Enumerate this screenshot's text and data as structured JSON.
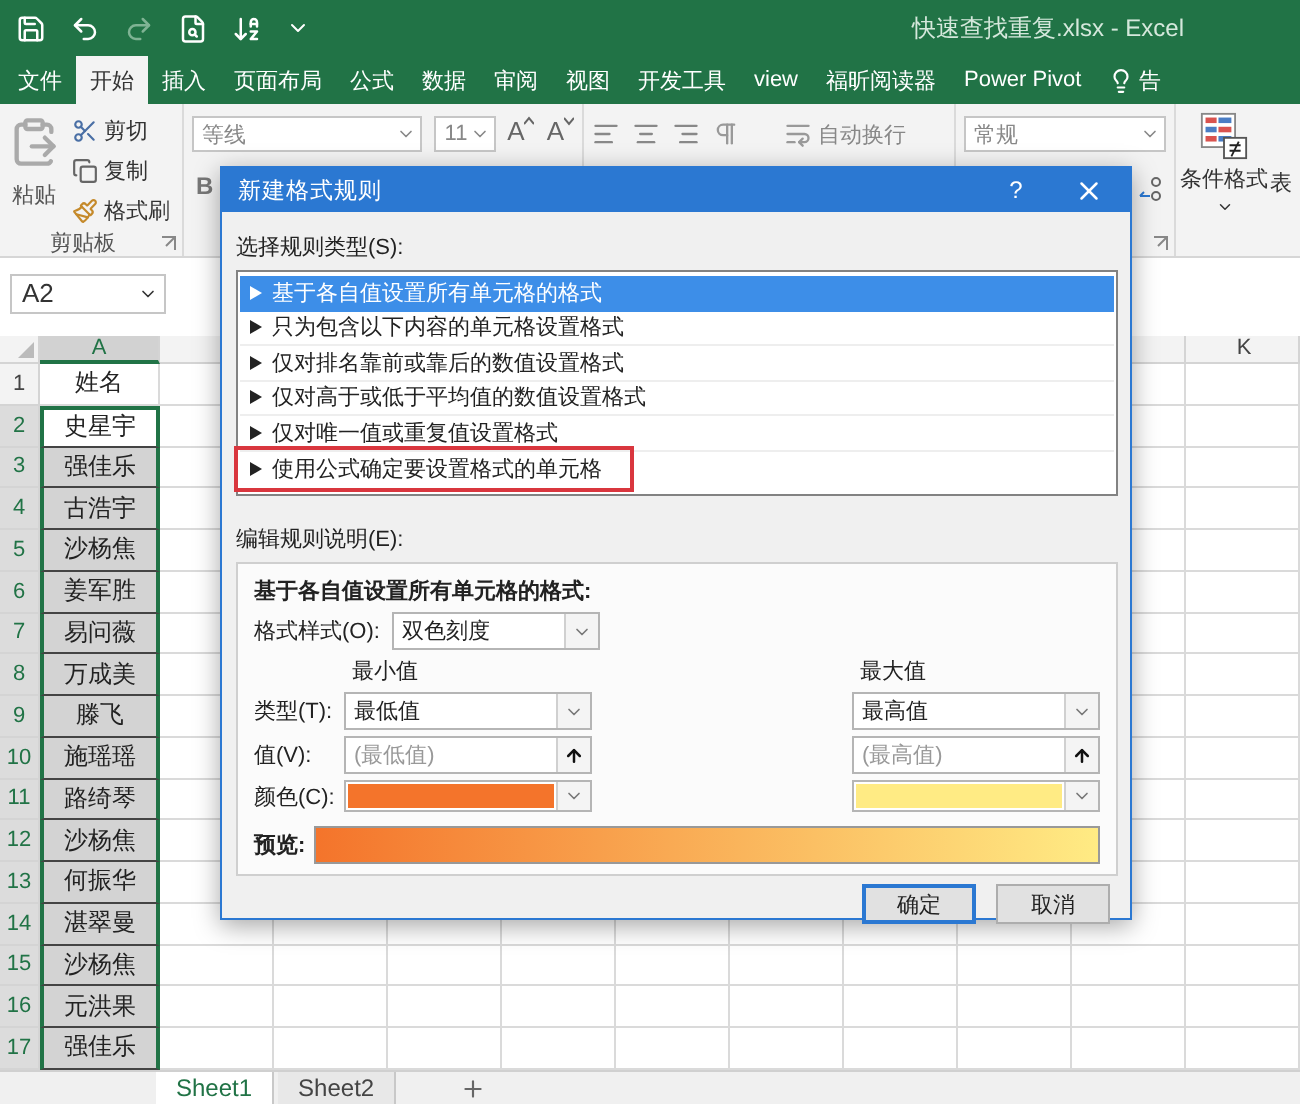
{
  "window": {
    "title": "快速查找重复.xlsx  -  Excel"
  },
  "ribbon_tabs": [
    {
      "label": "文件",
      "selected": false
    },
    {
      "label": "开始",
      "selected": true
    },
    {
      "label": "插入",
      "selected": false
    },
    {
      "label": "页面布局",
      "selected": false
    },
    {
      "label": "公式",
      "selected": false
    },
    {
      "label": "数据",
      "selected": false
    },
    {
      "label": "审阅",
      "selected": false
    },
    {
      "label": "视图",
      "selected": false
    },
    {
      "label": "开发工具",
      "selected": false
    },
    {
      "label": "view",
      "selected": false
    },
    {
      "label": "福昕阅读器",
      "selected": false
    },
    {
      "label": "Power Pivot",
      "selected": false
    }
  ],
  "tell_me": {
    "label": "告"
  },
  "ribbon": {
    "clipboard": {
      "paste": "粘贴",
      "cut": "剪切",
      "copy": "复制",
      "format_painter": "格式刷",
      "group_label": "剪贴板"
    },
    "font": {
      "name": "等线",
      "size": "11",
      "grow": "A",
      "shrink": "A",
      "bold": "B"
    },
    "alignment": {
      "wrap_text": "自动换行"
    },
    "number": {
      "format": "常规"
    },
    "styles": {
      "conditional_formatting": "条件格式",
      "table": "表"
    }
  },
  "name_box": "A2",
  "columns": {
    "first": "A",
    "last": "K"
  },
  "rows": [
    {
      "number": "1",
      "name": "姓名",
      "selected": false,
      "active": false
    },
    {
      "number": "2",
      "name": "史星宇",
      "selected": true,
      "active": true
    },
    {
      "number": "3",
      "name": "强佳乐",
      "selected": true,
      "active": false
    },
    {
      "number": "4",
      "name": "古浩宇",
      "selected": true,
      "active": false
    },
    {
      "number": "5",
      "name": "沙杨焦",
      "selected": true,
      "active": false
    },
    {
      "number": "6",
      "name": "姜军胜",
      "selected": true,
      "active": false
    },
    {
      "number": "7",
      "name": "易问薇",
      "selected": true,
      "active": false
    },
    {
      "number": "8",
      "name": "万成美",
      "selected": true,
      "active": false
    },
    {
      "number": "9",
      "name": "滕飞",
      "selected": true,
      "active": false
    },
    {
      "number": "10",
      "name": "施瑶瑶",
      "selected": true,
      "active": false
    },
    {
      "number": "11",
      "name": "路绮琴",
      "selected": true,
      "active": false
    },
    {
      "number": "12",
      "name": "沙杨焦",
      "selected": true,
      "active": false
    },
    {
      "number": "13",
      "name": "何振华",
      "selected": true,
      "active": false
    },
    {
      "number": "14",
      "name": "湛翠曼",
      "selected": true,
      "active": false
    },
    {
      "number": "15",
      "name": "沙杨焦",
      "selected": true,
      "active": false
    },
    {
      "number": "16",
      "name": "元洪果",
      "selected": true,
      "active": false
    },
    {
      "number": "17",
      "name": "强佳乐",
      "selected": true,
      "active": false
    }
  ],
  "sheets": [
    {
      "label": "Sheet1",
      "selected": true
    },
    {
      "label": "Sheet2",
      "selected": false
    }
  ],
  "dialog": {
    "title": "新建格式规则",
    "help": "?",
    "rule_type_label": "选择规则类型(S):",
    "rule_types": [
      {
        "label": "基于各自值设置所有单元格的格式",
        "selected": true,
        "highlighted": false
      },
      {
        "label": "只为包含以下内容的单元格设置格式",
        "selected": false,
        "highlighted": false
      },
      {
        "label": "仅对排名靠前或靠后的数值设置格式",
        "selected": false,
        "highlighted": false
      },
      {
        "label": "仅对高于或低于平均值的数值设置格式",
        "selected": false,
        "highlighted": false
      },
      {
        "label": "仅对唯一值或重复值设置格式",
        "selected": false,
        "highlighted": false
      },
      {
        "label": "使用公式确定要设置格式的单元格",
        "selected": false,
        "highlighted": true
      }
    ],
    "description_label": "编辑规则说明(E):",
    "description_heading": "基于各自值设置所有单元格的格式:",
    "format_style_label": "格式样式(O):",
    "format_style": "双色刻度",
    "type_label": "类型(T):",
    "value_label": "值(V):",
    "color_label": "颜色(C):",
    "preview_label": "预览:",
    "minimum": {
      "heading": "最小值",
      "type": "最低值",
      "value_placeholder": "(最低值)",
      "color": "#f4742b"
    },
    "maximum": {
      "heading": "最大值",
      "type": "最高值",
      "value_placeholder": "(最高值)",
      "color": "#ffeb84"
    },
    "buttons": [
      {
        "label": "确定",
        "kind": "default"
      },
      {
        "label": "取消",
        "kind": "normal"
      }
    ]
  }
}
